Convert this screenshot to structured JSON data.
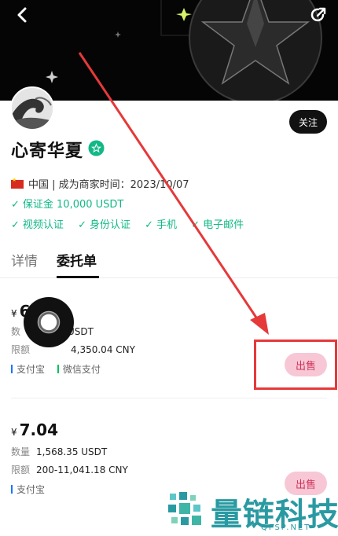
{
  "merchant": {
    "name": "心寄华夏",
    "follow_label": "关注",
    "location_line": "中国 | 成为商家时间：2023/10/07",
    "deposit": "保证金 10,000 USDT",
    "certifications": [
      "视频认证",
      "身份认证",
      "手机",
      "电子邮件"
    ]
  },
  "tabs": [
    {
      "label": "详情"
    },
    {
      "label": "委托单"
    }
  ],
  "orders": [
    {
      "currency": "¥",
      "price": "6",
      "quantity_label": "数",
      "quantity": "USDT",
      "limit_label": "限额",
      "limit": "4,350.04 CNY",
      "payments": [
        "支付宝",
        "微信支付"
      ],
      "action": "出售"
    },
    {
      "currency": "¥",
      "price": "7.04",
      "quantity_label": "数量",
      "quantity": "1,568.35 USDT",
      "limit_label": "限额",
      "limit": "200-11,041.18 CNY",
      "payments": [
        "支付宝"
      ],
      "action": "出售"
    }
  ],
  "watermark": {
    "text": "量链科技",
    "sub": "QFSP.NET"
  },
  "colors": {
    "accent_green": "#12b886",
    "sell_button_bg": "#f8c7d5",
    "sell_button_text": "#d0335a",
    "alipay_mark": "#1677ff",
    "wechat_mark": "#07c160",
    "annotation_red": "#e5393a",
    "watermark": "#2a9aa2"
  },
  "icons": {
    "back": "chevron-left-icon",
    "share": "share-icon",
    "verified": "star-badge-icon",
    "check": "check-icon"
  }
}
